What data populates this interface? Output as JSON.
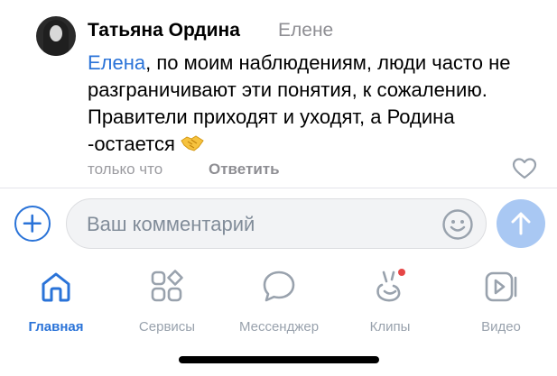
{
  "comment": {
    "author": "Татьяна Ордина",
    "reply_to": "Елене",
    "mention": "Елена",
    "text": ", по моим наблюдениям, люди часто не разграничивают эти понятия, к сожалению. Правители приходят и уходят, а Родина -остается",
    "time": "только что",
    "reply_label": "Ответить",
    "emoji_icon": "handshake-icon"
  },
  "composer": {
    "placeholder": "Ваш комментарий",
    "value": ""
  },
  "tabs": [
    {
      "label": "Главная",
      "icon": "home-icon",
      "active": true
    },
    {
      "label": "Сервисы",
      "icon": "services-icon",
      "active": false
    },
    {
      "label": "Мессенджер",
      "icon": "messenger-icon",
      "active": false
    },
    {
      "label": "Клипы",
      "icon": "clips-icon",
      "active": false,
      "badge": true
    },
    {
      "label": "Видео",
      "icon": "video-icon",
      "active": false
    }
  ],
  "colors": {
    "accent": "#2a73d8",
    "secondary_text": "#8e8e93",
    "tab_inactive": "#99a2ad",
    "send_disabled": "#a9c8f3",
    "badge": "#e64646"
  }
}
